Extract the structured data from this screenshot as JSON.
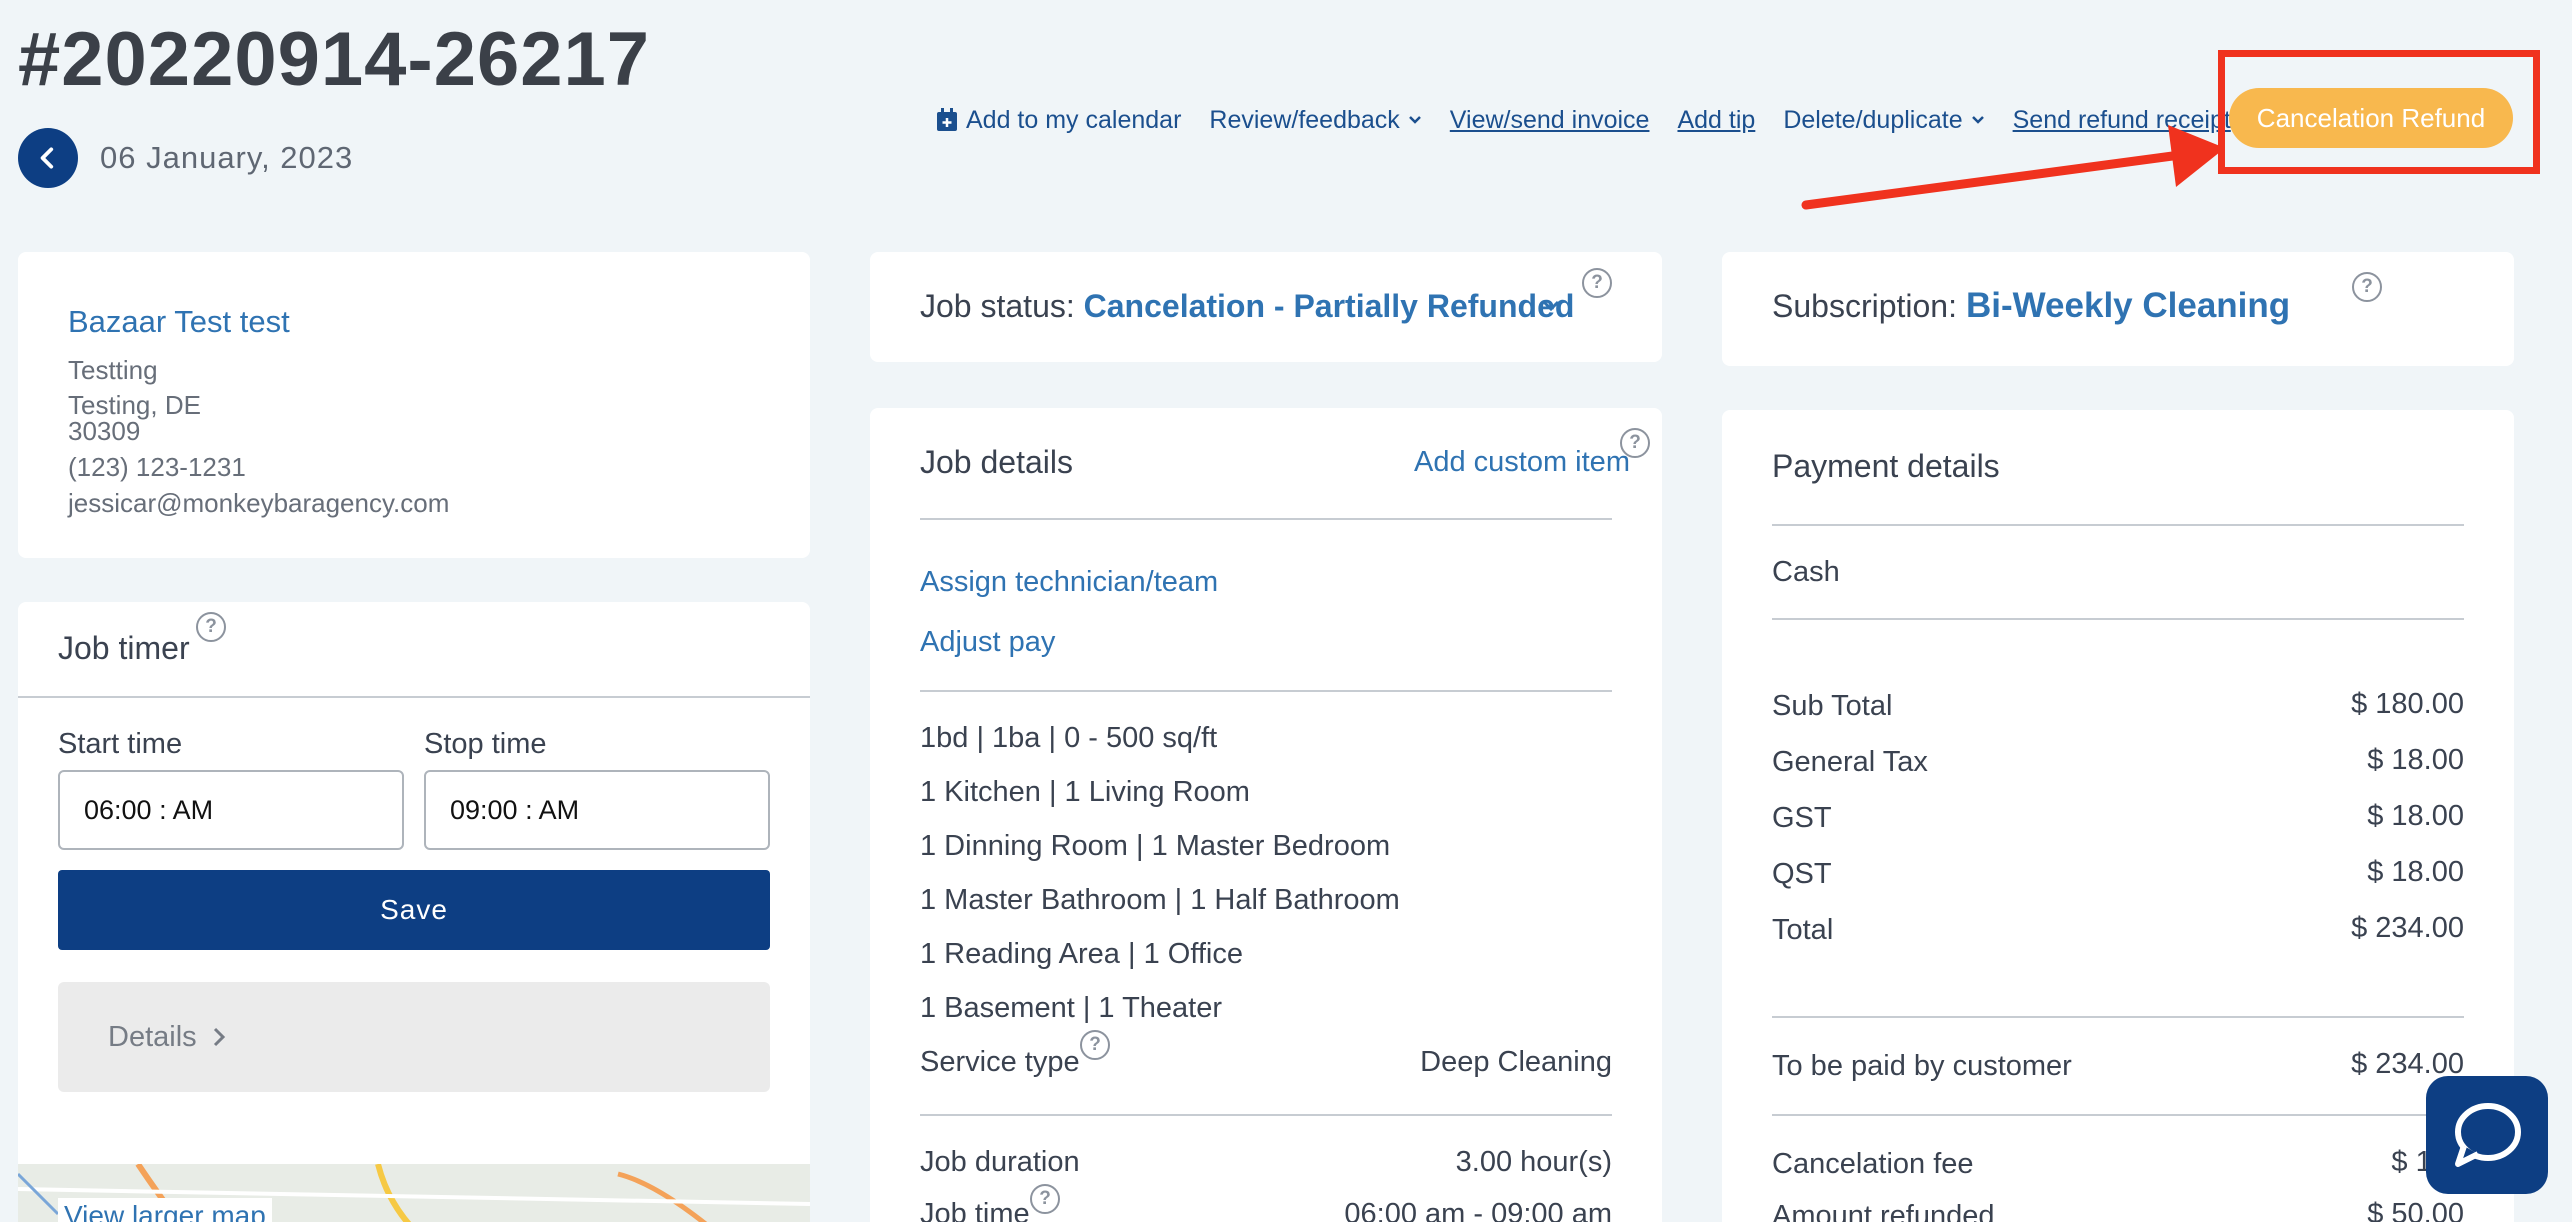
{
  "header": {
    "order_number": "#20220914-26217",
    "date": "06 January, 2023"
  },
  "toolbar": {
    "add_calendar": "Add to my calendar",
    "review_feedback": "Review/feedback",
    "view_invoice": "View/send invoice",
    "add_tip": "Add tip",
    "delete_duplicate": "Delete/duplicate",
    "send_refund_receipt": "Send refund receipt",
    "cancelation_refund": "Cancelation Refund"
  },
  "customer": {
    "name": "Bazaar Test test",
    "address1": "Testting",
    "address2": "Testing, DE",
    "zip": "30309",
    "phone": "(123) 123-1231",
    "email": "jessicar@monkeybaragency.com"
  },
  "timer": {
    "title": "Job timer",
    "start_label": "Start time",
    "stop_label": "Stop time",
    "start_value": "06:00 : AM",
    "stop_value": "09:00 : AM",
    "save_label": "Save",
    "details_label": "Details",
    "map_link": "View larger map"
  },
  "job_status": {
    "label": "Job status:",
    "value": "Cancelation - Partially Refunded"
  },
  "job_details": {
    "title": "Job details",
    "add_custom": "Add custom item",
    "assign": "Assign technician/team",
    "adjust_pay": "Adjust pay",
    "lines": [
      "1bd | 1ba | 0 - 500 sq/ft",
      "1 Kitchen | 1 Living Room",
      "1 Dinning Room | 1 Master Bedroom",
      "1 Master Bathroom | 1 Half Bathroom",
      "1 Reading Area | 1 Office",
      "1 Basement | 1 Theater"
    ],
    "service_type_label": "Service type",
    "service_type_value": "Deep Cleaning",
    "duration_label": "Job duration",
    "duration_value": "3.00 hour(s)",
    "time_label": "Job time",
    "time_value": "06:00 am - 09:00 am"
  },
  "subscription": {
    "label": "Subscription:",
    "value": "Bi-Weekly Cleaning"
  },
  "payment": {
    "title": "Payment details",
    "method": "Cash",
    "rows": [
      {
        "label": "Sub Total",
        "value": "$ 180.00"
      },
      {
        "label": "General Tax",
        "value": "$ 18.00"
      },
      {
        "label": "GST",
        "value": "$ 18.00"
      },
      {
        "label": "QST",
        "value": "$ 18.00"
      },
      {
        "label": "Total",
        "value": "$ 234.00"
      }
    ],
    "to_be_paid_label": "To be paid by customer",
    "to_be_paid_value": "$ 234.00",
    "cancel_fee_label": "Cancelation fee",
    "cancel_fee_value": "$ 100",
    "refunded_label": "Amount refunded",
    "refunded_value": "$ 50.00"
  },
  "colors": {
    "primary": "#0d3e83",
    "link": "#2f73b2",
    "accent": "#f8b84e",
    "highlight": "#f0321e"
  }
}
